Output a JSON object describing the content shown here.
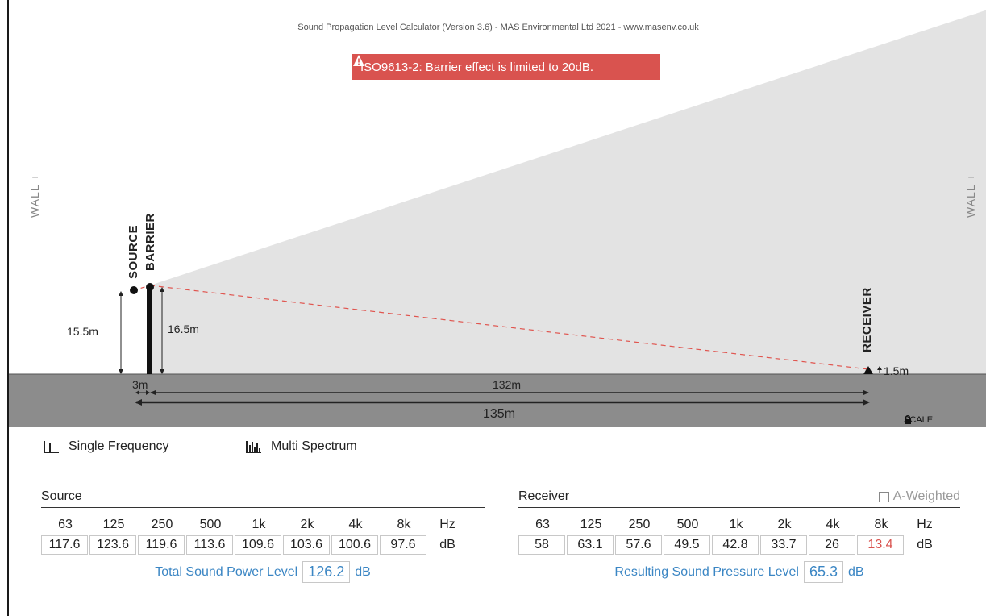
{
  "app_title": "Sound Propagation Level Calculator (Version 3.6) - MAS Environmental Ltd 2021 - www.masenv.co.uk",
  "warning": "ISO9613-2: Barrier effect is limited to 20dB.",
  "walls": {
    "left": "WALL +",
    "right": "WALL +"
  },
  "labels": {
    "source": "SOURCE",
    "barrier": "BARRIER",
    "receiver": "RECEIVER"
  },
  "dimensions": {
    "source_height": "15.5m",
    "barrier_height": "16.5m",
    "receiver_height": "1.5m",
    "source_to_barrier": "3m",
    "barrier_to_receiver": "132m",
    "total_distance": "135m"
  },
  "scale_label": "SCALE",
  "tabs": [
    {
      "label": "Single Frequency",
      "icon": "single-frequency-icon",
      "active": false
    },
    {
      "label": "Multi Spectrum",
      "icon": "multi-spectrum-icon",
      "active": true
    }
  ],
  "source": {
    "title": "Source",
    "freqs": [
      "63",
      "125",
      "250",
      "500",
      "1k",
      "2k",
      "4k",
      "8k"
    ],
    "unit_hz": "Hz",
    "values": [
      "117.6",
      "123.6",
      "119.6",
      "113.6",
      "109.6",
      "103.6",
      "100.6",
      "97.6"
    ],
    "unit_db": "dB",
    "total_label": "Total Sound Power Level",
    "total_value": "126.2",
    "total_unit": "dB"
  },
  "receiver": {
    "title": "Receiver",
    "a_weighted_label": "A-Weighted",
    "a_weighted_checked": false,
    "freqs": [
      "63",
      "125",
      "250",
      "500",
      "1k",
      "2k",
      "4k",
      "8k"
    ],
    "unit_hz": "Hz",
    "values": [
      "58",
      "63.1",
      "57.6",
      "49.5",
      "42.8",
      "33.7",
      "26",
      "13.4"
    ],
    "unit_db": "dB",
    "total_label": "Resulting Sound Pressure Level",
    "total_value": "65.3",
    "total_unit": "dB"
  },
  "colors": {
    "warning_bg": "#d9534f",
    "ground": "#8c8c8c",
    "shadow_zone": "#e3e3e3",
    "accent_blue": "#3b86c4",
    "ray": "#e0554f"
  }
}
